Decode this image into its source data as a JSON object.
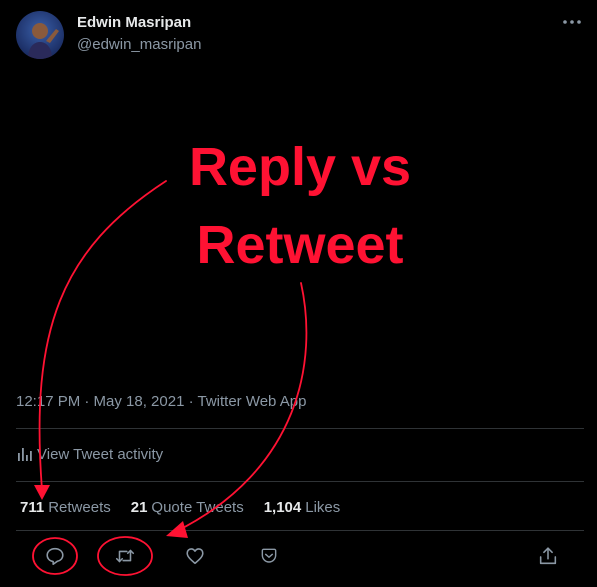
{
  "author": {
    "name": "Edwin Masripan",
    "handle": "@edwin_masripan"
  },
  "overlay": {
    "line1": "Reply vs",
    "line2": "Retweet",
    "color": "#ff1233"
  },
  "tweet_meta": {
    "timestamp": "12:17 PM · May 18, 2021 · Twitter Web App"
  },
  "activity": {
    "label": "View Tweet activity"
  },
  "stats": {
    "retweets_count": "711",
    "retweets_label": "Retweets",
    "quotes_count": "21",
    "quotes_label": "Quote Tweets",
    "likes_count": "1,104",
    "likes_label": "Likes"
  },
  "actions": {
    "icons": [
      "reply-icon",
      "retweet-icon",
      "like-icon",
      "save-icon",
      "share-icon"
    ]
  },
  "colors": {
    "background": "#000000",
    "primary_text": "#e7e9ea",
    "secondary_text": "#8b98a5",
    "divider": "#2f3336",
    "annotation": "#ff1233"
  }
}
